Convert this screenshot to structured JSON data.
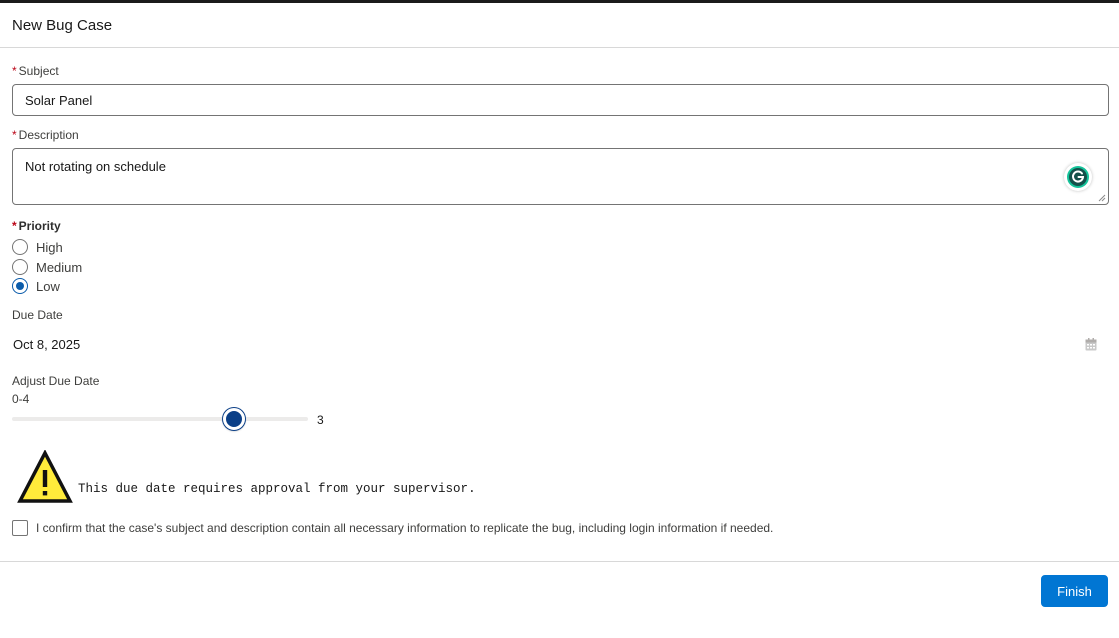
{
  "header": {
    "title": "New Bug Case"
  },
  "form": {
    "subject": {
      "label": "Subject",
      "required_mark": "*",
      "value": "Solar Panel"
    },
    "description": {
      "label": "Description",
      "required_mark": "*",
      "value": "Not rotating on schedule",
      "assistant_icon": "grammarly-icon"
    },
    "priority": {
      "label": "Priority",
      "required_mark": "*",
      "options": [
        {
          "label": "High",
          "selected": false
        },
        {
          "label": "Medium",
          "selected": false
        },
        {
          "label": "Low",
          "selected": true
        }
      ]
    },
    "due_date": {
      "label": "Due Date",
      "value": "Oct 8, 2025",
      "icon": "calendar-icon"
    },
    "adjust_due_date": {
      "label": "Adjust Due Date",
      "range_label": "0-4",
      "min": 0,
      "max": 4,
      "value": "3"
    },
    "warning": {
      "icon": "warning-icon",
      "text": "This due date requires approval from your supervisor."
    },
    "confirm": {
      "label": "I confirm that the case's subject and description contain all necessary information to replicate the bug, including login information if needed.",
      "checked": false
    }
  },
  "footer": {
    "finish_label": "Finish"
  },
  "colors": {
    "brand": "#0176d3",
    "required": "#ba0517",
    "slider_thumb": "#0b3f87",
    "warning_fill": "#ffeb3b"
  }
}
